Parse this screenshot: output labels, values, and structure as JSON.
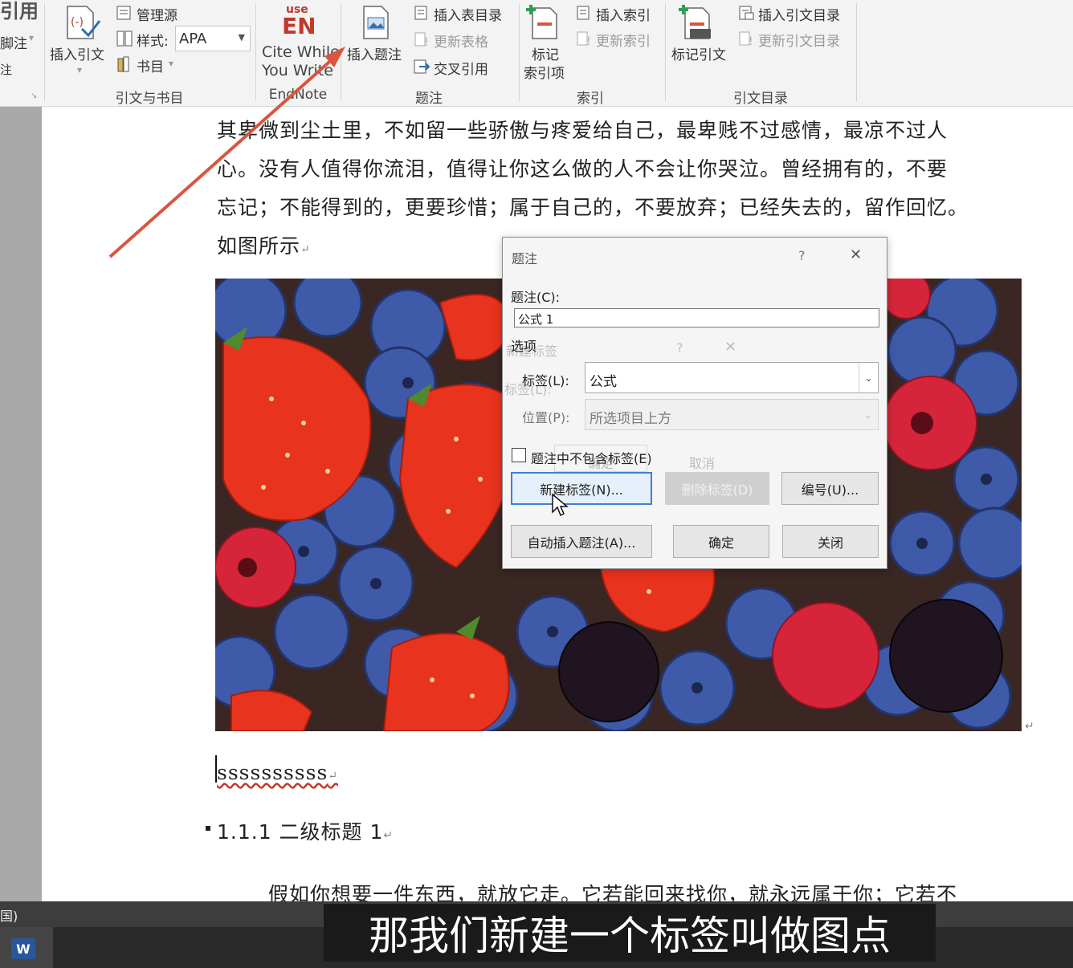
{
  "ribbon": {
    "tab_title": "引用",
    "left_cut_labels": [
      "脚注",
      "注"
    ],
    "citations": {
      "insert_citation": "插入引文",
      "manage_sources": "管理源",
      "style_label": "样式:",
      "style_value": "APA",
      "bibliography": "书目",
      "group_label": "引文与书目"
    },
    "endnote": {
      "logo_top": "use",
      "logo_main": "EN",
      "cite_line1": "Cite While",
      "cite_line2": "You Write",
      "group_label": "EndNote"
    },
    "captions": {
      "insert_caption": "插入题注",
      "insert_table_of_figures": "插入表目录",
      "update_table": "更新表格",
      "cross_reference": "交叉引用",
      "group_label": "题注"
    },
    "index": {
      "mark_entry_line1": "标记",
      "mark_entry_line2": "索引项",
      "insert_index": "插入索引",
      "update_index": "更新索引",
      "group_label": "索引"
    },
    "authorities": {
      "mark_citation": "标记引文",
      "insert_table": "插入引文目录",
      "update_table": "更新引文目录",
      "group_label": "引文目录"
    }
  },
  "document": {
    "lines": [
      "其卑微到尘土里，不如留一些骄傲与疼爱给自己，最卑贱不过感情，最凉不过人",
      "心。没有人值得你流泪，值得让你这么做的人不会让你哭泣。曾经拥有的，不要",
      "忘记；不能得到的，更要珍惜；属于自己的，不要放弃；已经失去的，留作回忆。",
      "如图所示"
    ],
    "typed_text": "ssssssssss",
    "heading": "1.1.1 二级标题 1",
    "bottom_line": "假如你想要一件东西，就放它走。它若能回来找你，就永远属于你；它若不",
    "para_mark": "↵"
  },
  "dialog": {
    "title": "题注",
    "help": "?",
    "close_x": "✕",
    "caption_label": "题注(C):",
    "caption_value": "公式 1",
    "options_label": "选项",
    "label_label": "标签(L):",
    "label_value": "公式",
    "position_label": "位置(P):",
    "position_value": "所选项目上方",
    "exclude_label": "题注中不包含标签(E)",
    "btn_new_label": "新建标签(N)...",
    "btn_delete_label": "删除标签(D)",
    "btn_numbering": "编号(U)...",
    "btn_autocaption": "自动插入题注(A)...",
    "btn_ok": "确定",
    "btn_close": "关闭",
    "ghost_title": "新建标签",
    "ghost_label": "标签(L):",
    "ghost_ok": "确定",
    "ghost_cancel": "取消"
  },
  "statusbar": {
    "lang_fragment": "国)"
  },
  "taskbar": {
    "word_icon_letter": "W"
  },
  "subtitle": "那我们新建一个标签叫做图点",
  "colors": {
    "arrow": "#d9553f",
    "dialog_focus": "#3c7fd6"
  }
}
